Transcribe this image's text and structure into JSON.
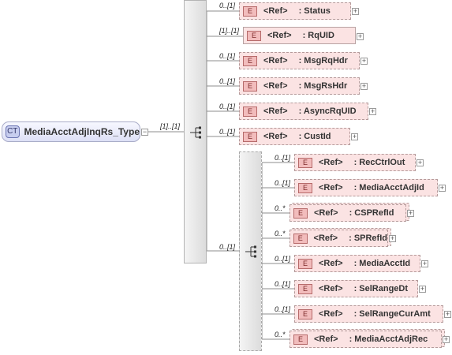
{
  "root": {
    "badge": "CT",
    "name": "MediaAcctAdjInqRs_Type",
    "cardinality": "[1]..[1]"
  },
  "element_badge": "E",
  "ref_label": "<Ref>",
  "outer_children": [
    {
      "name": ": Status",
      "card": "0..[1]"
    },
    {
      "name": ": RqUID",
      "card": "[1]..[1]"
    },
    {
      "name": ": MsgRqHdr",
      "card": "0..[1]"
    },
    {
      "name": ": MsgRsHdr",
      "card": "0..[1]"
    },
    {
      "name": ": AsyncRqUID",
      "card": "0..[1]"
    },
    {
      "name": ": CustId",
      "card": "0..[1]"
    }
  ],
  "inner_sequence_card": "0..[1]",
  "inner_children": [
    {
      "name": ": RecCtrlOut",
      "card": "0..[1]"
    },
    {
      "name": ": MediaAcctAdjId",
      "card": "0..[1]"
    },
    {
      "name": ": CSPRefId",
      "card": "0..*"
    },
    {
      "name": ": SPRefId",
      "card": "0..*"
    },
    {
      "name": ": MediaAcctId",
      "card": "0..[1]"
    },
    {
      "name": ": SelRangeDt",
      "card": "0..[1]"
    },
    {
      "name": ": SelRangeCurAmt",
      "card": "0..[1]"
    },
    {
      "name": ": MediaAcctAdjRec",
      "card": "0..*"
    }
  ]
}
